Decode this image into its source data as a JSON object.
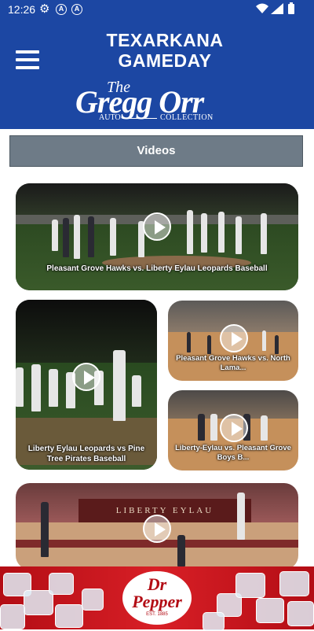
{
  "status": {
    "time": "12:26"
  },
  "header": {
    "title": "TEXARKANA GAMEDAY",
    "logo": {
      "the": "The",
      "name": "Gregg Orr",
      "auto": "AUTO",
      "collection": "COLLECTION"
    }
  },
  "section": {
    "title": "Videos"
  },
  "videos": [
    {
      "caption": "Pleasant Grove Hawks vs. Liberty Eylau Leopards Baseball"
    },
    {
      "caption": "Liberty Eylau Leopards vs Pine Tree Pirates Baseball"
    },
    {
      "caption": "Pleasant Grove Hawks vs. North Lama..."
    },
    {
      "caption": "Liberty-Eylau vs. Pleasant Grove Boys B..."
    },
    {
      "caption": "",
      "court_wall_text": "LIBERTY EYLAU"
    }
  ],
  "ad": {
    "brand_line1": "Dr",
    "brand_line2": "Pepper",
    "est": "EST. 1885"
  },
  "colors": {
    "header": "#1c47a3",
    "section_bar": "#6e7b87",
    "ad_red": "#d81f26"
  }
}
